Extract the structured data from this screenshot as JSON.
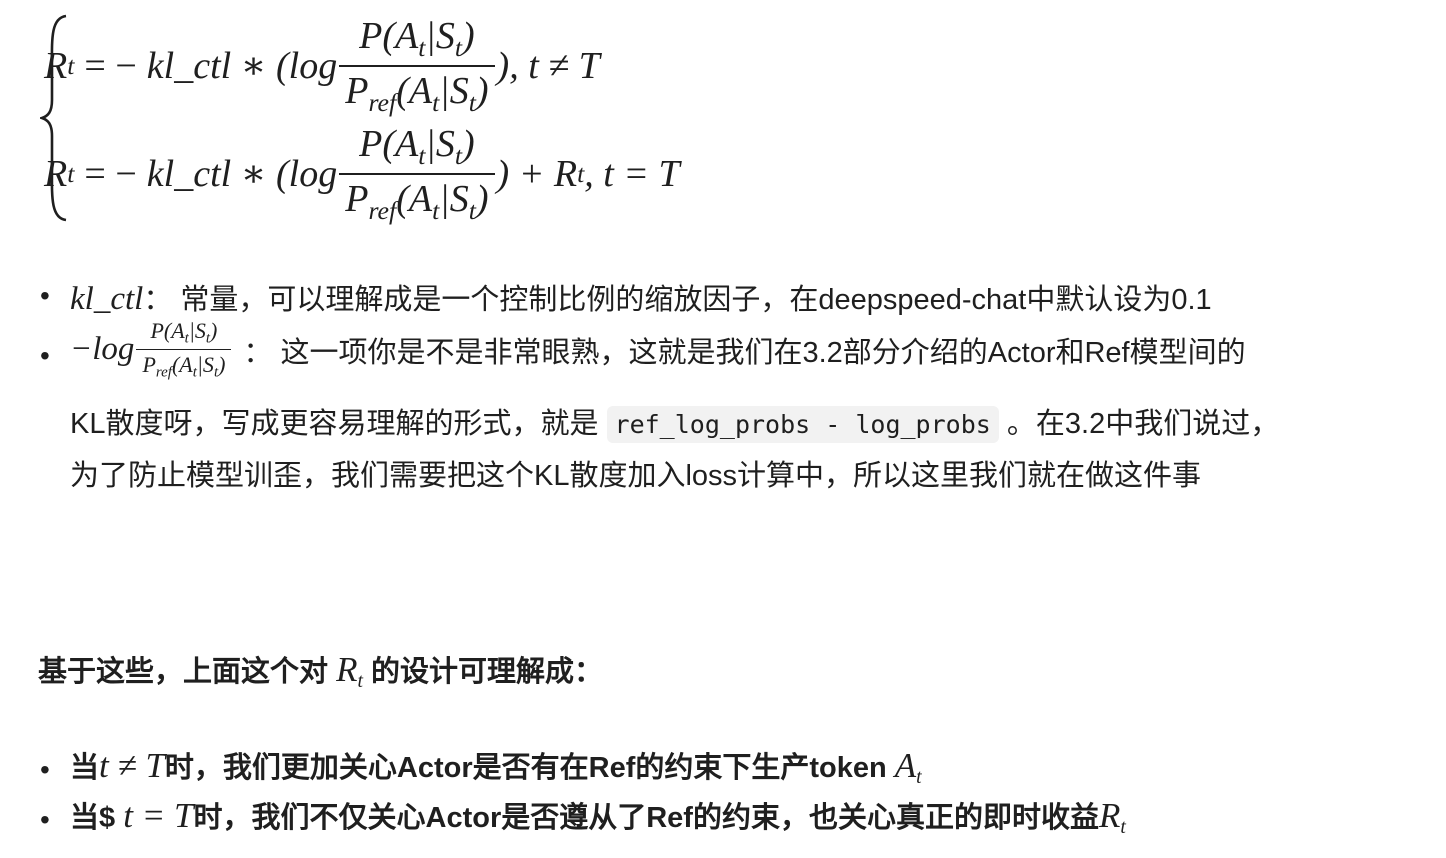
{
  "formula": {
    "case1": {
      "lhs": "R",
      "lhs_sub": "t",
      "eq": "= −",
      "coef": "kl_ctl ∗ (",
      "log": "log",
      "num": "P(A",
      "num_sub": "t",
      "num_mid": "|S",
      "num_sub2": "t",
      "num_end": ")",
      "den": "P",
      "den_sub": "ref",
      "den_mid": "(A",
      "den_sub2": "t",
      "den_mid2": "|S",
      "den_sub3": "t",
      "den_end": ")",
      "tail": "), t ≠ T"
    },
    "case2": {
      "lhs": "R",
      "lhs_sub": "t",
      "eq": "= −",
      "coef": "kl_ctl ∗ (",
      "log": "log",
      "num": "P(A",
      "num_sub": "t",
      "num_mid": "|S",
      "num_sub2": "t",
      "num_end": ")",
      "den": "P",
      "den_sub": "ref",
      "den_mid": "(A",
      "den_sub2": "t",
      "den_mid2": "|S",
      "den_sub3": "t",
      "den_end": ")",
      "tail_a": ") + R",
      "tail_sub": "t",
      "tail_b": ", t = T"
    }
  },
  "bullets": {
    "b1": {
      "term": "kl_ctl",
      "text": "： 常量，可以理解成是一个控制比例的缩放因子，在deepspeed-chat中默认设为0.1"
    },
    "b2": {
      "prefix": "−log",
      "num": "P(A",
      "num_sub": "t",
      "num_mid": "|S",
      "num_sub2": "t",
      "num_end": ")",
      "den": "P",
      "den_sub": "ref",
      "den_mid": "(A",
      "den_sub2": "t",
      "den_mid2": "|S",
      "den_sub3": "t",
      "den_end": ")",
      "text1": "： 这一项你是不是非常眼熟，这就是我们在3.2部分介绍的Actor和Ref模型间的",
      "text2a": "KL散度呀，写成更容易理解的形式，就是 ",
      "code": "ref_log_probs - log_probs",
      "text2b": " 。在3.2中我们说过，",
      "text3": "为了防止模型训歪，我们需要把这个KL散度加入loss计算中，所以这里我们就在做这件事"
    }
  },
  "summary": {
    "heading_a": "基于这些，上面这个对 ",
    "heading_var": "R",
    "heading_sub": "t",
    "heading_b": " 的设计可理解成："
  },
  "points": {
    "p1_a": "当",
    "p1_math": "t ≠ T",
    "p1_b": "时，我们更加关心Actor是否有在Ref的约束下生产token ",
    "p1_var": "A",
    "p1_sub": "t",
    "p2_a": "当$ ",
    "p2_math": "t = T",
    "p2_b": "时，我们不仅关心Actor是否遵从了Ref的约束，也关心真正的即时收益",
    "p2_var": "R",
    "p2_sub": "t"
  },
  "bullet_glyph": "•"
}
